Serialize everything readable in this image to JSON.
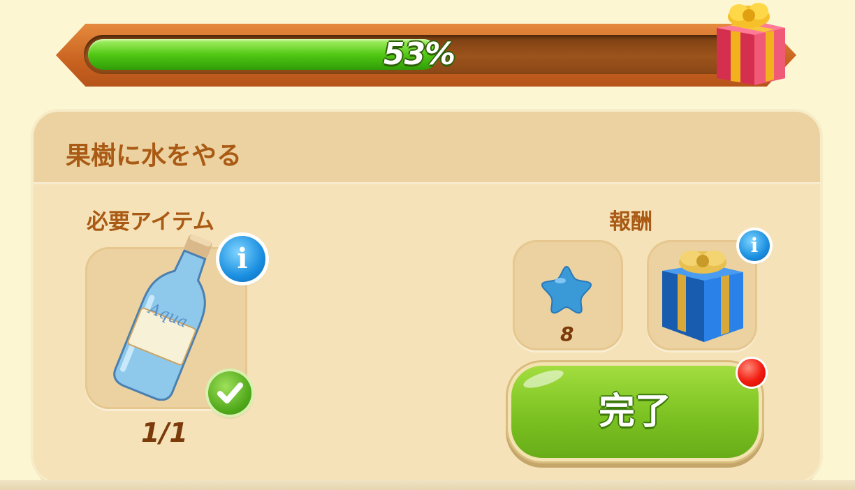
{
  "progress": {
    "percent_text": "53%",
    "fraction": 0.53
  },
  "quest": {
    "title": "果樹に水をやる",
    "required_label": "必要アイテム",
    "reward_label": "報酬",
    "required_item": {
      "icon": "water-bottle-icon",
      "bottle_text": "Aqua",
      "count": "1/1",
      "completed": true
    },
    "rewards": [
      {
        "icon": "blue-star-icon",
        "amount": "8"
      },
      {
        "icon": "blue-gift-box-icon"
      }
    ],
    "complete_button": "完了"
  },
  "colors": {
    "title_brown": "#a95a14",
    "progress_green": "#52c814",
    "button_green": "#7cc222",
    "info_blue": "#1b8fe0",
    "notify_red": "#f21a0e"
  }
}
